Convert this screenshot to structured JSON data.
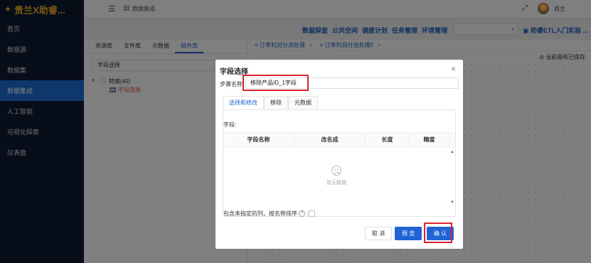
{
  "app": {
    "name": "贵兰X助睿..."
  },
  "sidebar": {
    "items": [
      {
        "label": "首页"
      },
      {
        "label": "数据源"
      },
      {
        "label": "数据集"
      },
      {
        "label": "数据集成"
      },
      {
        "label": "人工智能"
      },
      {
        "label": "可视化探索"
      },
      {
        "label": "仪表盘"
      }
    ]
  },
  "header": {
    "breadcrumb": "数据集成",
    "user": "肖兰"
  },
  "subnav": {
    "links": [
      "数据探查",
      "公共空间",
      "调度计划",
      "任务管理",
      "环境管理"
    ],
    "project": "助睿ETL入门实验 ..."
  },
  "library": {
    "tabs": [
      "资源库",
      "文件库",
      "元数据",
      "组件库"
    ],
    "active_tab": "组件库",
    "search_value": "字段选择",
    "tree": {
      "parent": "转换(40)",
      "child": "字段选择"
    }
  },
  "canvas": {
    "tabs": [
      {
        "label": "订单利润分流处理",
        "close": "×"
      },
      {
        "label": "订单利润分流处理5",
        "close": "×"
      }
    ],
    "status": "当前画布已保存"
  },
  "dialog": {
    "title": "字段选择",
    "close": "×",
    "step_label": "步骤名称",
    "step_value": "移除产品ID_1字段",
    "tabs": [
      "选择和修改",
      "移除",
      "元数据"
    ],
    "fields_label": "字段:",
    "table": {
      "columns": [
        "字段名称",
        "改名成",
        "长度",
        "精度"
      ],
      "empty_text": "暂无数据"
    },
    "include_label": "包含未指定的列，按名称排序",
    "include_suffix": ":",
    "buttons": {
      "cancel": "取 消",
      "preview": "预 览",
      "confirm": "确 认"
    },
    "highlight_color": "#d9232e"
  },
  "colors": {
    "sidebar_bg": "#0f1d33",
    "active_blue": "#1d6fd6",
    "brand": "#f5b52a",
    "link": "#1f5fbf"
  }
}
